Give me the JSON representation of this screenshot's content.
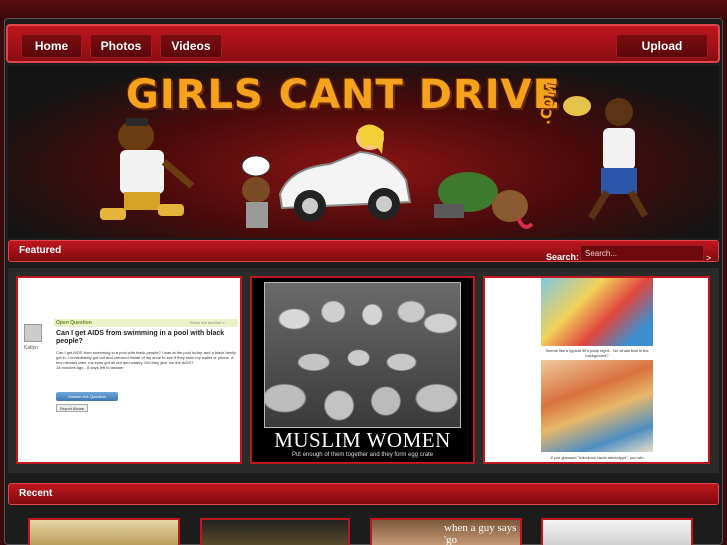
{
  "nav": {
    "items": [
      {
        "label": "Home"
      },
      {
        "label": "Photos"
      },
      {
        "label": "Videos"
      }
    ],
    "upload_label": "Upload"
  },
  "banner": {
    "logo_text": "GIRLS CANT DRIVE",
    "logo_suffix": ".COM"
  },
  "featured": {
    "title": "Featured",
    "search_label": "Search:",
    "search_placeholder": "Search...",
    "search_go": ">",
    "items": [
      {
        "open_question": "Open Question",
        "favorite": "Show me another »",
        "asker": "Katlyn",
        "question": "Can I get AIDS from swimming in a pool with black people?",
        "details": "Can I get AIDS from swimming in a pool with black people? I was at the pool today, and a black family got in. I immediately got out and checked inside of my shoe to see if they stole my wallet or phone. A few minutes later, my eyes got all red and watery. Did they give me the AIDS?",
        "meta": "18 minutes ago - 5 days left to answer.",
        "answer_button": "Answer this Question",
        "report_button": "Report Abuse"
      },
      {
        "poster_title": "MUSLIM WOMEN",
        "poster_subtitle": "Put enough of them together and they form egg crate"
      },
      {
        "caption_top": "Seems like a typical 90's party night... No whats that in the background?",
        "caption_bottom": "If you guessed \"ridiculous racist stereotype\", you win"
      }
    ]
  },
  "recent": {
    "title": "Recent",
    "items": [
      {
        "label": ""
      },
      {
        "label": ""
      },
      {
        "label": "when a guy says 'go"
      },
      {
        "label": ""
      }
    ]
  }
}
